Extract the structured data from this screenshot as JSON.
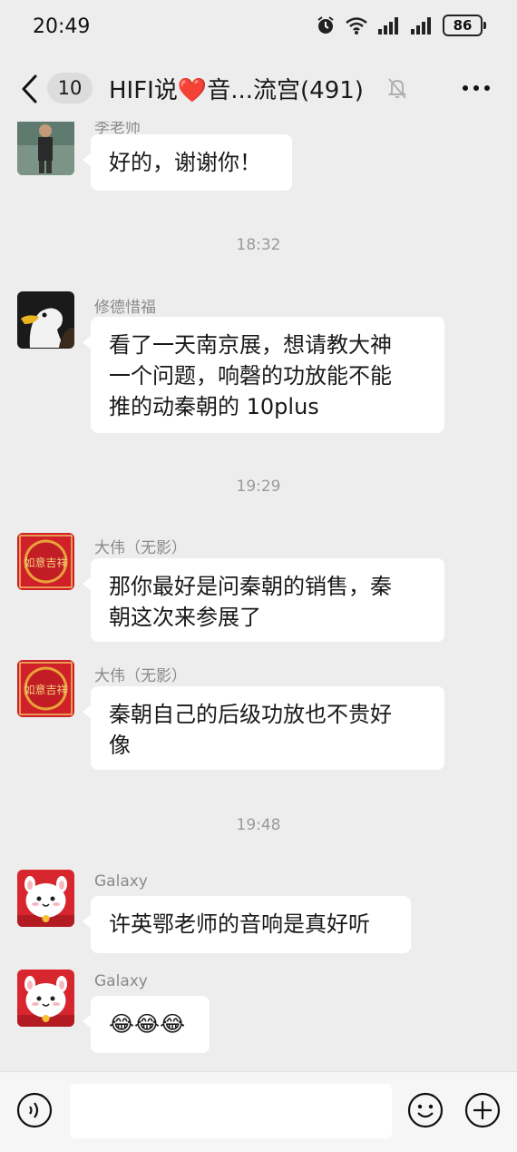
{
  "status": {
    "time": "20:49",
    "battery": "86"
  },
  "header": {
    "unread": "10",
    "title": "HIFI说❤️音...流宫(491)"
  },
  "messages": {
    "m1": {
      "sender": "李老师",
      "text": "好的，谢谢你！"
    },
    "t1": "18:32",
    "m2": {
      "sender": "修德惜福",
      "line1": "看了一天南京展，想请教大神",
      "line2": "一个问题，响磬的功放能不能",
      "line3": "推的动秦朝的 10plus"
    },
    "t2": "19:29",
    "m3": {
      "sender": "大伟（无影）",
      "line1": "那你最好是问秦朝的销售，秦",
      "line2": "朝这次来参展了"
    },
    "m4": {
      "sender": "大伟（无影）",
      "line1": "秦朝自己的后级功放也不贵好",
      "line2": "像"
    },
    "t3": "19:48",
    "m5": {
      "sender": "Galaxy",
      "text": "许英鄂老师的音响是真好听"
    },
    "m6": {
      "sender": "Galaxy",
      "text": "😂😂😂"
    }
  },
  "avatar_text": {
    "lucky": "如意吉祥"
  },
  "icons": [
    "alarm-icon",
    "wifi-icon",
    "signal-icon",
    "back-icon",
    "mute-bell-icon",
    "more-icon",
    "voice-icon",
    "emoji-icon",
    "plus-icon"
  ],
  "colors": {
    "background": "#ededed",
    "bubble": "#ffffff",
    "red_avatar": "#d0202a"
  }
}
